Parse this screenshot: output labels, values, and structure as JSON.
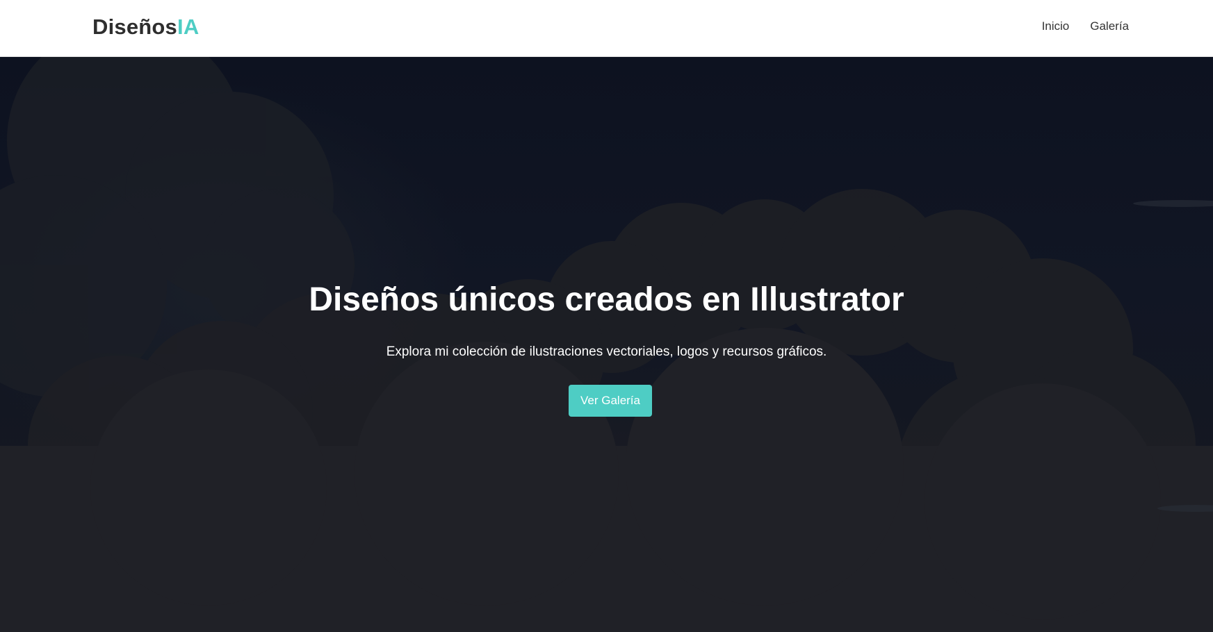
{
  "header": {
    "logo_main": "Diseños",
    "logo_accent": "IA",
    "nav": [
      {
        "label": "Inicio"
      },
      {
        "label": "Galería"
      }
    ]
  },
  "hero": {
    "title": "Diseños únicos creados en Illustrator",
    "subtitle": "Explora mi colección de ilustraciones vectoriales, logos y recursos gráficos.",
    "button_label": "Ver Galería"
  },
  "colors": {
    "accent": "#4ecdc4",
    "header_bg": "#ffffff",
    "hero_bg": "#0f1420",
    "text_dark": "#2e2e2e"
  }
}
